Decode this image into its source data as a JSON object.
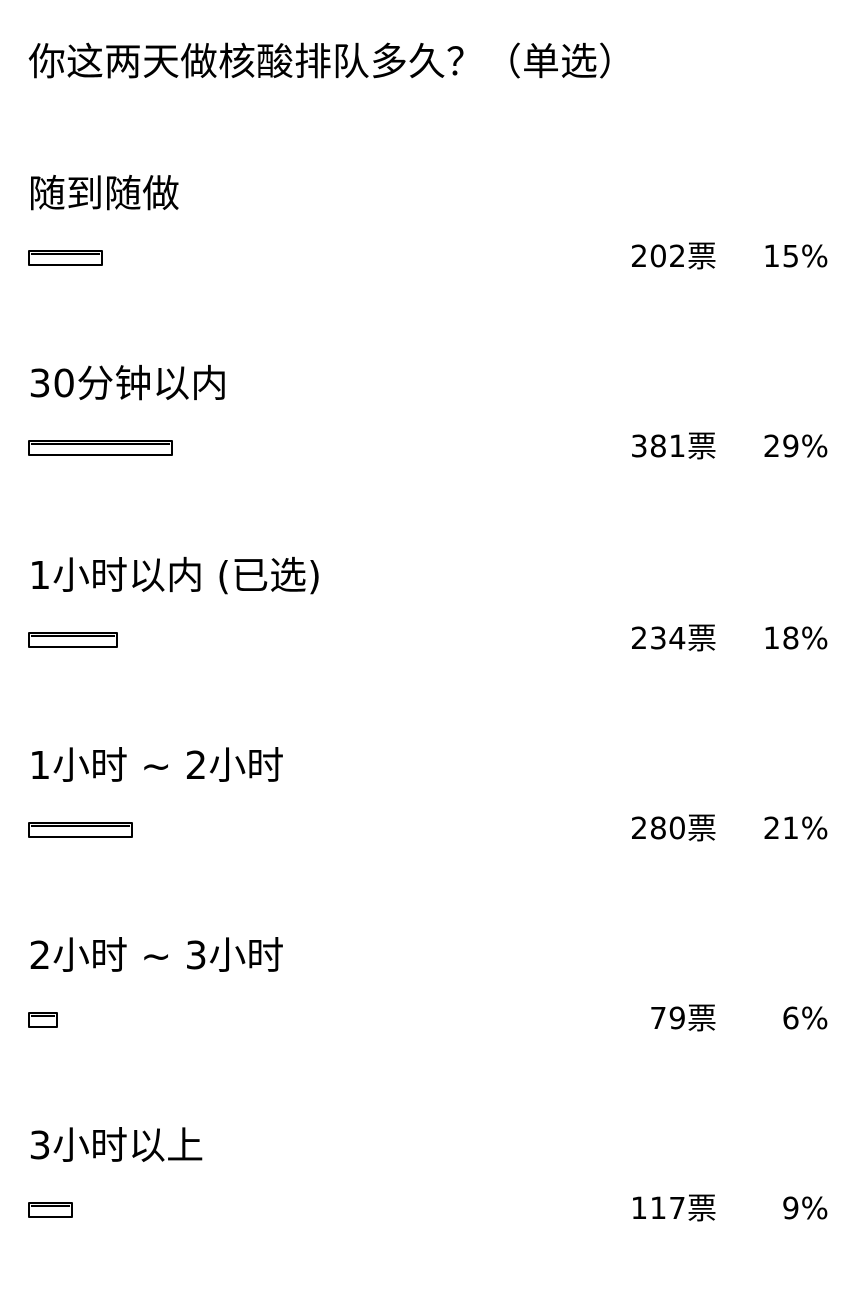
{
  "poll": {
    "title": "你这两天做核酸排队多久？（单选）",
    "options": [
      {
        "label": "随到随做",
        "votes": "202票",
        "percent": "15%",
        "share": 0.15
      },
      {
        "label": "30分钟以内",
        "votes": "381票",
        "percent": "29%",
        "share": 0.29
      },
      {
        "label": "1小时以内 (已选)",
        "votes": "234票",
        "percent": "18%",
        "share": 0.18
      },
      {
        "label": "1小时 ~ 2小时",
        "votes": "280票",
        "percent": "21%",
        "share": 0.21
      },
      {
        "label": "2小时 ~ 3小时",
        "votes": "79票",
        "percent": "6%",
        "share": 0.06
      },
      {
        "label": "3小时以上",
        "votes": "117票",
        "percent": "9%",
        "share": 0.09
      }
    ]
  }
}
